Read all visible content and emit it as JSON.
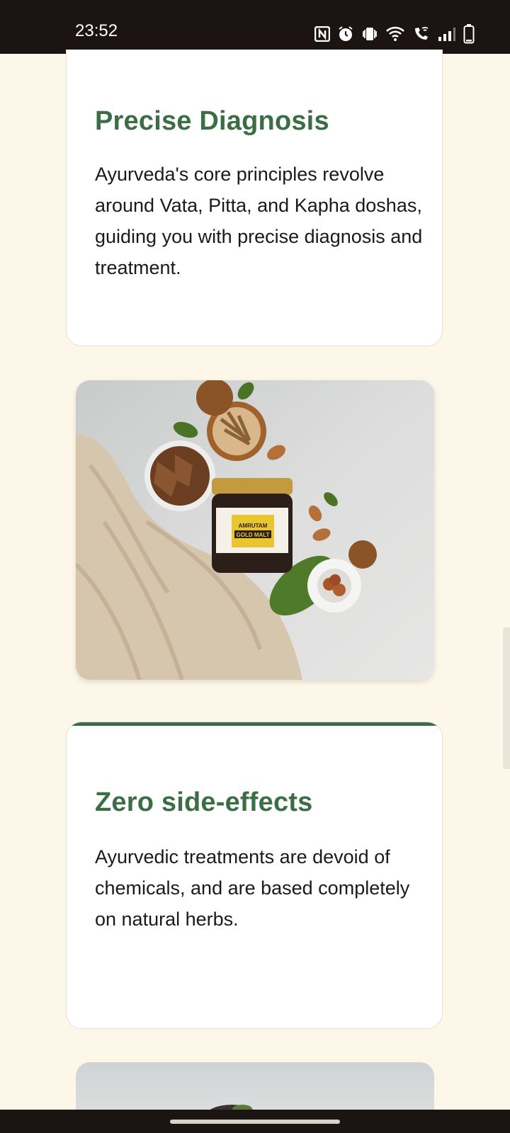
{
  "status_bar": {
    "time": "23:52",
    "icons": [
      "nfc-icon",
      "alarm-icon",
      "vibrate-icon",
      "wifi-icon",
      "wifi-calling-icon",
      "signal-icon",
      "battery-icon"
    ]
  },
  "cards": [
    {
      "title": "Precise Diagnosis",
      "body": "Ayurveda's core principles revolve around Vata, Pitta, and Kapha doshas, guiding you with precise diagnosis and treatment."
    },
    {
      "title": "Zero side-effects",
      "body": "Ayurvedic treatments are devoid of chemicals, and are based completely on natural herbs."
    }
  ],
  "product_image": {
    "label_line1": "AMRUTAM",
    "label_line2": "GOLD MALT"
  },
  "colors": {
    "accent_green": "#3C6E45",
    "page_background": "#FDF7EA",
    "system_bar": "#1C1413"
  }
}
